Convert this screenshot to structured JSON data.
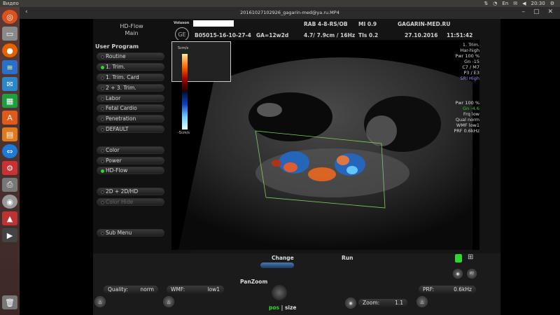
{
  "topbar": {
    "app": "Видео",
    "clock": "20:30"
  },
  "window": {
    "title": "20161027102926_gagarin-med@ya.ru.MP4"
  },
  "header": {
    "logo_line1": "HD-Flow",
    "logo_line2": "Main",
    "volume_label": "Voluson",
    "probe": "RAB 4-8-RS/OB",
    "mi": "MI  0.9",
    "site": "GAGARIN-MED.RU",
    "patient_id": "B05015-16-10-27-4",
    "ga": "GA=12w2d",
    "depth": "4.7/ 7.9cm / 16Hz",
    "tis": "TIs  0.2",
    "date": "27.10.2016",
    "time": "11:51:42"
  },
  "menu": {
    "title": "User Program",
    "items": [
      {
        "label": "Routine"
      },
      {
        "label": "1. Trim."
      },
      {
        "label": "1. Trim. Card"
      },
      {
        "label": "2 + 3. Trim."
      },
      {
        "label": "Labor"
      },
      {
        "label": "Fetal Cardio"
      },
      {
        "label": "Penetration"
      },
      {
        "label": "DEFAULT"
      }
    ],
    "mode_items": [
      {
        "label": "Color"
      },
      {
        "label": "Power"
      },
      {
        "label": "HD-Flow"
      }
    ],
    "extra": [
      {
        "label": "2D + 2D/HD"
      },
      {
        "label": "Color Hide"
      }
    ],
    "submenu": "Sub Menu"
  },
  "colorbar": {
    "top": "5cm/s",
    "bottom": "-5cm/s"
  },
  "params_top": [
    "1. Trim.",
    "Har-high",
    "Pwr 100 %",
    "Gn -15",
    "C7 / M7",
    "P3 / E3",
    "SRI High"
  ],
  "params_flow": [
    "Pwr 100 %",
    "Gn -4.6",
    "Frq low",
    "Qual norm",
    "WMF low1",
    "PRF  0.6kHz"
  ],
  "bottom": {
    "change": "Change",
    "run": "Run",
    "panzoom": "PanZoom",
    "pos": "pos",
    "size": "size",
    "quality_label": "Quality:",
    "quality_value": "norm",
    "wmf_label": "WMF:",
    "wmf_value": "low1",
    "prf_label": "PRF:",
    "prf_value": "0.6kHz",
    "zoom_label": "Zoom:",
    "zoom_value": "1.1",
    "help": "P?"
  },
  "colors": {
    "accent_green": "#2ed62e",
    "roi": "#7bcf5c"
  }
}
